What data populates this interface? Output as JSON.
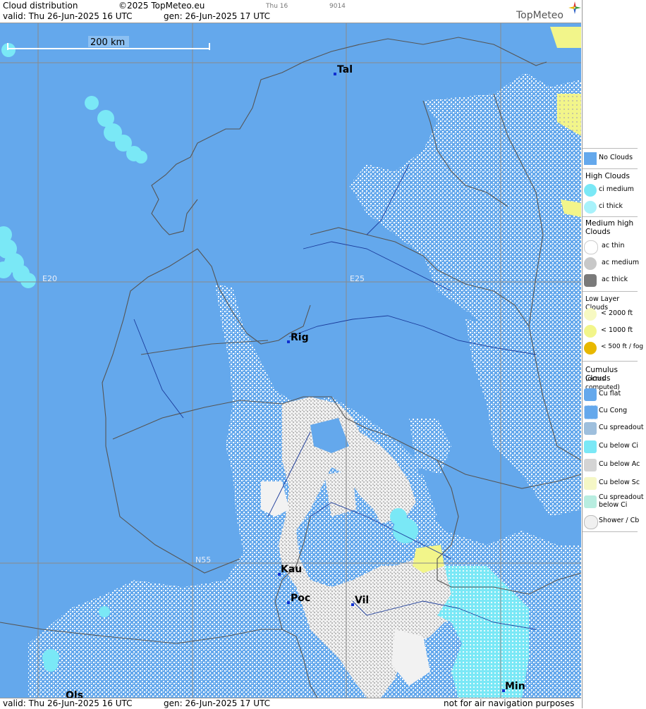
{
  "header": {
    "title": "Cloud distribution",
    "copyright": "©2025 TopMeteo.eu",
    "small_code_1": "Thu 16",
    "small_code_2": "9014",
    "valid_label": "valid:  Thu  26-Jun-2025  16 UTC",
    "gen_label": "gen: 26-Jun-2025 17 UTC",
    "logo_text": "TopMeteo"
  },
  "footer": {
    "valid_label": "valid:  Thu  26-Jun-2025  16 UTC",
    "gen_label": "gen: 26-Jun-2025 17 UTC",
    "disclaimer": "not for air navigation purposes"
  },
  "map": {
    "scale_label": "200 km",
    "grid_labels": {
      "lon1": "E20",
      "lon2": "E25",
      "lat1": "N55"
    },
    "cities": [
      "Tal",
      "Rig",
      "Kau",
      "Poc",
      "Vil",
      "Min",
      "Ols"
    ],
    "colors": {
      "no_clouds": "#64a8ec",
      "cu_flat": "#ffffff",
      "overcast": "#f2f2f2",
      "cu_below_ac": "#c8c8c8",
      "ci": "#7ae8f6",
      "low_yellow": "#f2f58a",
      "border": "#555555",
      "river": "#1a3a9a"
    }
  },
  "legend": {
    "no_clouds": "No Clouds",
    "high_heading": "High Clouds",
    "ci_medium": "ci medium",
    "ci_thick": "ci thick",
    "medium_heading_1": "Medium high",
    "medium_heading_2": "Clouds",
    "ac_thin": "ac thin",
    "ac_medium": "ac medium",
    "ac_thick": "ac thick",
    "low_heading": "Low Layer Clouds",
    "low_2000": "< 2000 ft",
    "low_1000": "< 1000 ft",
    "low_500": "< 500 ft / fog",
    "cumulus_heading": "Cumulus Clouds",
    "cumulus_sub": "(octas computed)",
    "cu_flat": "Cu flat",
    "cu_cong": "Cu Cong",
    "cu_spreadout": "Cu spreadout",
    "cu_below_ci": "Cu below Ci",
    "cu_below_ac": "Cu below Ac",
    "cu_below_sc": "Cu below Sc",
    "cu_spreadout_below_ci_1": "Cu spreadout",
    "cu_spreadout_below_ci_2": "below Ci",
    "shower_cb": "Shower / Cb"
  }
}
